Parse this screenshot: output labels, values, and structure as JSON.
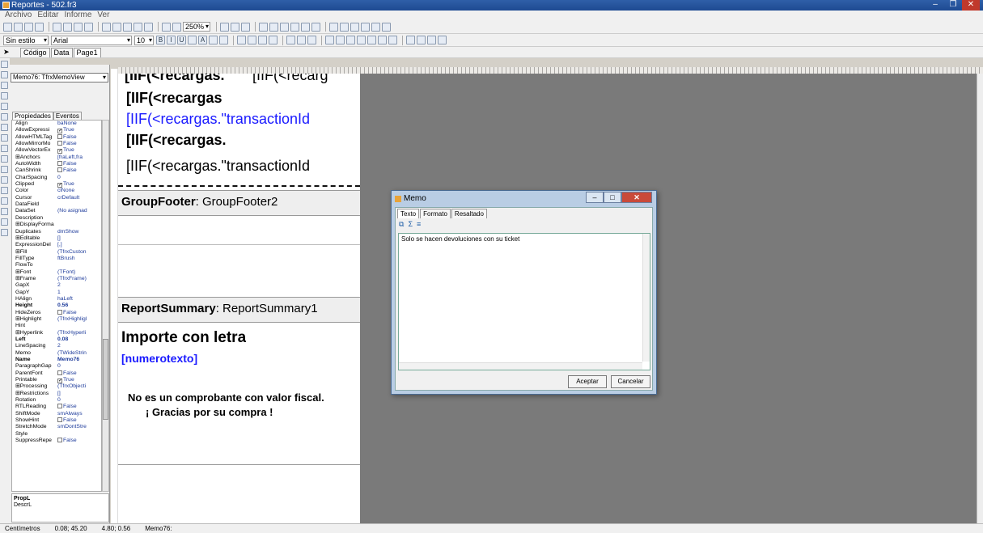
{
  "window": {
    "title": "Reportes - 502.fr3"
  },
  "menu": [
    "Archivo",
    "Editar",
    "Informe",
    "Ver"
  ],
  "format": {
    "style": "Sin estilo",
    "font": "Arial",
    "size": "10",
    "zoom": "250%"
  },
  "tabs": [
    "Código",
    "Data",
    "Page1"
  ],
  "inspector": {
    "object": "Memo76: TfrxMemoView",
    "tabs": [
      "Propiedades",
      "Eventos"
    ],
    "props": [
      [
        "Align",
        "baNone",
        0,
        ""
      ],
      [
        "AllowExpressi",
        "True",
        0,
        "chk1"
      ],
      [
        "AllowHTMLTag",
        "False",
        0,
        "chk0"
      ],
      [
        "AllowMirrorMo",
        "False",
        0,
        "chk0"
      ],
      [
        "AllowVectorEx",
        "True",
        0,
        "chk1"
      ],
      [
        "⊞Anchors",
        "[fraLeft,fra",
        0,
        ""
      ],
      [
        "AutoWidth",
        "False",
        0,
        "chk0"
      ],
      [
        "CanShrink",
        "False",
        0,
        "chk0"
      ],
      [
        "CharSpacing",
        "0",
        0,
        ""
      ],
      [
        "Clipped",
        "True",
        0,
        "chk1"
      ],
      [
        "Color",
        "clNone",
        0,
        ""
      ],
      [
        "Cursor",
        "crDefault",
        0,
        ""
      ],
      [
        "DataField",
        "",
        0,
        ""
      ],
      [
        "DataSet",
        "(No asignad",
        0,
        ""
      ],
      [
        "Description",
        "",
        0,
        ""
      ],
      [
        "⊞DisplayForma",
        "",
        0,
        ""
      ],
      [
        "Duplicates",
        "dmShow",
        0,
        ""
      ],
      [
        "⊞Editable",
        "[]",
        0,
        ""
      ],
      [
        "ExpressionDel",
        "[,]",
        0,
        ""
      ],
      [
        "⊞Fill",
        "(TfrxCuston",
        0,
        ""
      ],
      [
        "FillType",
        "ftBrush",
        0,
        ""
      ],
      [
        "FlowTo",
        "",
        0,
        ""
      ],
      [
        "⊞Font",
        "(TFont)",
        0,
        ""
      ],
      [
        "⊞Frame",
        "(TfrxFrame)",
        0,
        ""
      ],
      [
        "GapX",
        "2",
        0,
        ""
      ],
      [
        "GapY",
        "1",
        0,
        ""
      ],
      [
        "HAlign",
        "haLeft",
        0,
        ""
      ],
      [
        "Height",
        "0.56",
        1,
        ""
      ],
      [
        "HideZeros",
        "False",
        0,
        "chk0"
      ],
      [
        "⊞Highlight",
        "(TfrxHighligl",
        0,
        ""
      ],
      [
        "Hint",
        "",
        0,
        ""
      ],
      [
        "⊞Hyperlink",
        "(TfrxHyperli",
        0,
        ""
      ],
      [
        "Left",
        "0.08",
        1,
        ""
      ],
      [
        "LineSpacing",
        "2",
        0,
        ""
      ],
      [
        "Memo",
        "(TWideStrin",
        0,
        ""
      ],
      [
        "Name",
        "Memo76",
        1,
        ""
      ],
      [
        "ParagraphGap",
        "0",
        0,
        ""
      ],
      [
        "ParentFont",
        "False",
        0,
        "chk0"
      ],
      [
        "Printable",
        "True",
        0,
        "chk1"
      ],
      [
        "⊞Processing",
        "(TfrxObjecti",
        0,
        ""
      ],
      [
        "⊞Restrictions",
        "[]",
        0,
        ""
      ],
      [
        "Rotation",
        "0",
        0,
        ""
      ],
      [
        "RTLReading",
        "False",
        0,
        "chk0"
      ],
      [
        "ShiftMode",
        "smAlways",
        0,
        ""
      ],
      [
        "ShowHint",
        "False",
        0,
        "chk0"
      ],
      [
        "StretchMode",
        "smDontStre",
        0,
        ""
      ],
      [
        "Style",
        "",
        0,
        ""
      ],
      [
        "SuppressRepe",
        "False",
        0,
        "chk0"
      ]
    ],
    "bottom_title": "PropL",
    "bottom_desc": "DescrL"
  },
  "design": {
    "memo1": "[IIF(<recargas.",
    "memo1b": "[IIF(<recarg",
    "memo2": "[IIF(<recargas",
    "memo3": "[IIF(<recargas.\"transactionId",
    "memo4": "[IIF(<recargas.",
    "memo5": "[IIF(<recargas.\"transactionId",
    "group_footer_label": "GroupFooter",
    "group_footer_name": ": GroupFooter2",
    "summary_label": "ReportSummary",
    "summary_name": ": ReportSummary1",
    "importe": "Importe con letra",
    "numerotexto": "[numerotexto]",
    "fiscal": "No es un comprobante con valor fiscal.",
    "gracias": "¡ Gracias por su compra !"
  },
  "dialog": {
    "title": "Memo",
    "tabs": [
      "Texto",
      "Formato",
      "Resaltado"
    ],
    "text": "Solo se hacen devoluciones con su ticket",
    "ok": "Aceptar",
    "cancel": "Cancelar"
  },
  "status": {
    "units": "Centímetros",
    "pos": "0.08; 45.20",
    "size": "4.80; 0.56",
    "name": "Memo76:"
  }
}
